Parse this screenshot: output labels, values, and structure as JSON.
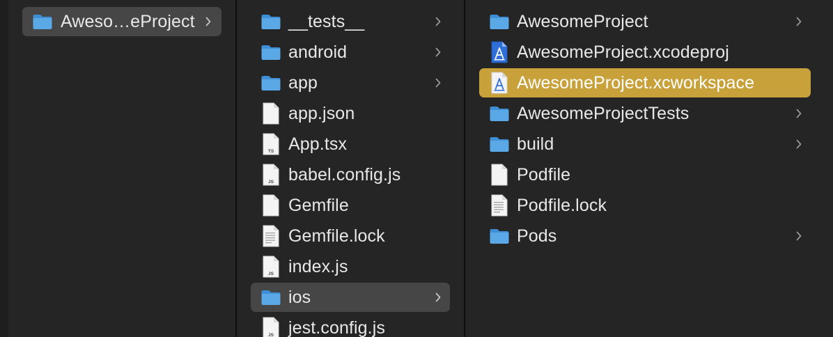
{
  "columns": [
    {
      "items": [
        {
          "label": "Aweso…eProject",
          "icon": "folder-icon",
          "chevron": true,
          "selected": "gray"
        }
      ]
    },
    {
      "items": [
        {
          "label": "__tests__",
          "icon": "folder-icon",
          "chevron": true
        },
        {
          "label": "android",
          "icon": "folder-icon",
          "chevron": true
        },
        {
          "label": "app",
          "icon": "folder-icon",
          "chevron": true
        },
        {
          "label": "app.json",
          "icon": "blank-file-icon",
          "chevron": false
        },
        {
          "label": "App.tsx",
          "icon": "ts-file-icon",
          "chevron": false
        },
        {
          "label": "babel.config.js",
          "icon": "js-file-icon",
          "chevron": false
        },
        {
          "label": "Gemfile",
          "icon": "blank-file-icon",
          "chevron": false
        },
        {
          "label": "Gemfile.lock",
          "icon": "text-file-icon",
          "chevron": false
        },
        {
          "label": "index.js",
          "icon": "js-file-icon",
          "chevron": false
        },
        {
          "label": "ios",
          "icon": "folder-icon",
          "chevron": true,
          "selected": "gray"
        },
        {
          "label": "jest.config.js",
          "icon": "js-file-icon",
          "chevron": false
        }
      ]
    },
    {
      "items": [
        {
          "label": "AwesomeProject",
          "icon": "folder-icon",
          "chevron": true
        },
        {
          "label": "AwesomeProject.xcodeproj",
          "icon": "xcode-project-icon",
          "chevron": false
        },
        {
          "label": "AwesomeProject.xcworkspace",
          "icon": "xcode-workspace-icon",
          "chevron": false,
          "selected": "gold"
        },
        {
          "label": "AwesomeProjectTests",
          "icon": "folder-icon",
          "chevron": true
        },
        {
          "label": "build",
          "icon": "folder-icon",
          "chevron": true
        },
        {
          "label": "Podfile",
          "icon": "blank-file-icon",
          "chevron": false
        },
        {
          "label": "Podfile.lock",
          "icon": "text-file-icon",
          "chevron": false
        },
        {
          "label": "Pods",
          "icon": "folder-icon",
          "chevron": true
        }
      ]
    }
  ],
  "colors": {
    "background": "#1e1e1e",
    "column": "#252525",
    "selection_inactive": "#464646",
    "selection_active": "#c9a13a",
    "folder_blue": "#5aa9e6",
    "text": "#e8e8e8"
  },
  "file_badges": {
    "ts": "TS",
    "js": "JS"
  }
}
